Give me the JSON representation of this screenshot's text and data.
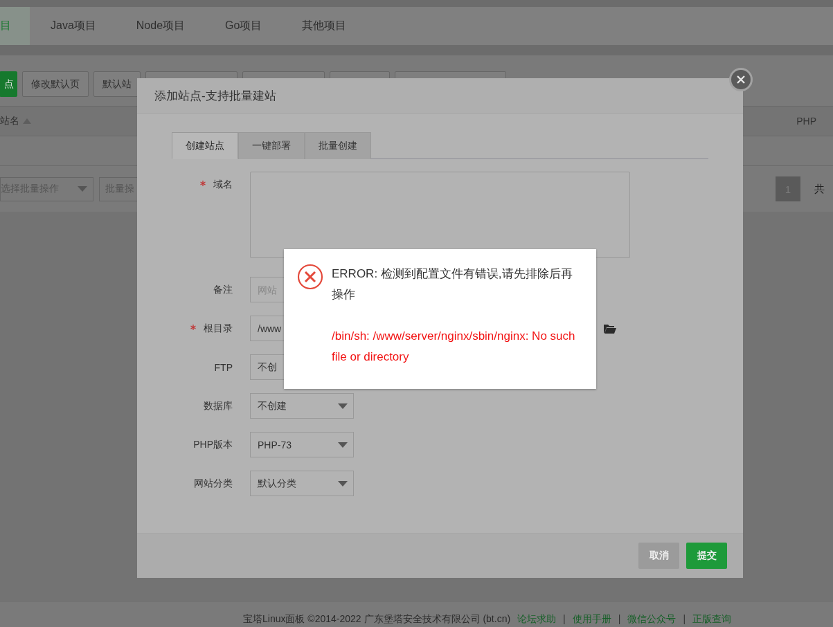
{
  "top_tabs": [
    {
      "label": "目",
      "selected": true
    },
    {
      "label": "Java项目",
      "selected": false
    },
    {
      "label": "Node项目",
      "selected": false
    },
    {
      "label": "Go项目",
      "selected": false
    },
    {
      "label": "其他项目",
      "selected": false
    }
  ],
  "toolbar": {
    "buttons": [
      {
        "label": "点",
        "kind": "primary"
      },
      {
        "label": "修改默认页",
        "kind": "default"
      },
      {
        "label": "默认站",
        "kind": "default"
      }
    ]
  },
  "table": {
    "columns": [
      "站名",
      "PHP"
    ]
  },
  "batch": {
    "select": "选择批量操作",
    "button": "批量操"
  },
  "pagination": {
    "current": "1",
    "total_label": "共"
  },
  "dialog": {
    "title": "添加站点-支持批量建站",
    "tabs": [
      {
        "label": "创建站点",
        "selected": true
      },
      {
        "label": "一键部署",
        "selected": false
      },
      {
        "label": "批量创建",
        "selected": false
      }
    ],
    "fields": [
      {
        "label": "域名",
        "required": true,
        "kind": "textarea"
      },
      {
        "label": "备注",
        "required": false,
        "kind": "input",
        "placeholder": "网站"
      },
      {
        "label": "根目录",
        "required": true,
        "kind": "path",
        "value": "/www"
      },
      {
        "label": "FTP",
        "required": false,
        "kind": "select",
        "value": "不创"
      },
      {
        "label": "数据库",
        "required": false,
        "kind": "select",
        "value": "不创建"
      },
      {
        "label": "PHP版本",
        "required": false,
        "kind": "select",
        "value": "PHP-73"
      },
      {
        "label": "网站分类",
        "required": false,
        "kind": "select",
        "value": "默认分类"
      }
    ],
    "buttons": [
      {
        "label": "取消",
        "kind": "cancel"
      },
      {
        "label": "提交",
        "kind": "submit"
      }
    ]
  },
  "error": {
    "message": "ERROR: 检测到配置文件有错误,请先排除后再操作",
    "detail": "/bin/sh: /www/server/nginx/sbin/nginx: No such file or directory"
  },
  "footer": {
    "copyright": "宝塔Linux面板 ©2014-2022 广东堡塔安全技术有限公司 (bt.cn)",
    "separator": "|",
    "links": [
      "论坛求助",
      "使用手册",
      "微信公众号",
      "正版查询"
    ]
  }
}
